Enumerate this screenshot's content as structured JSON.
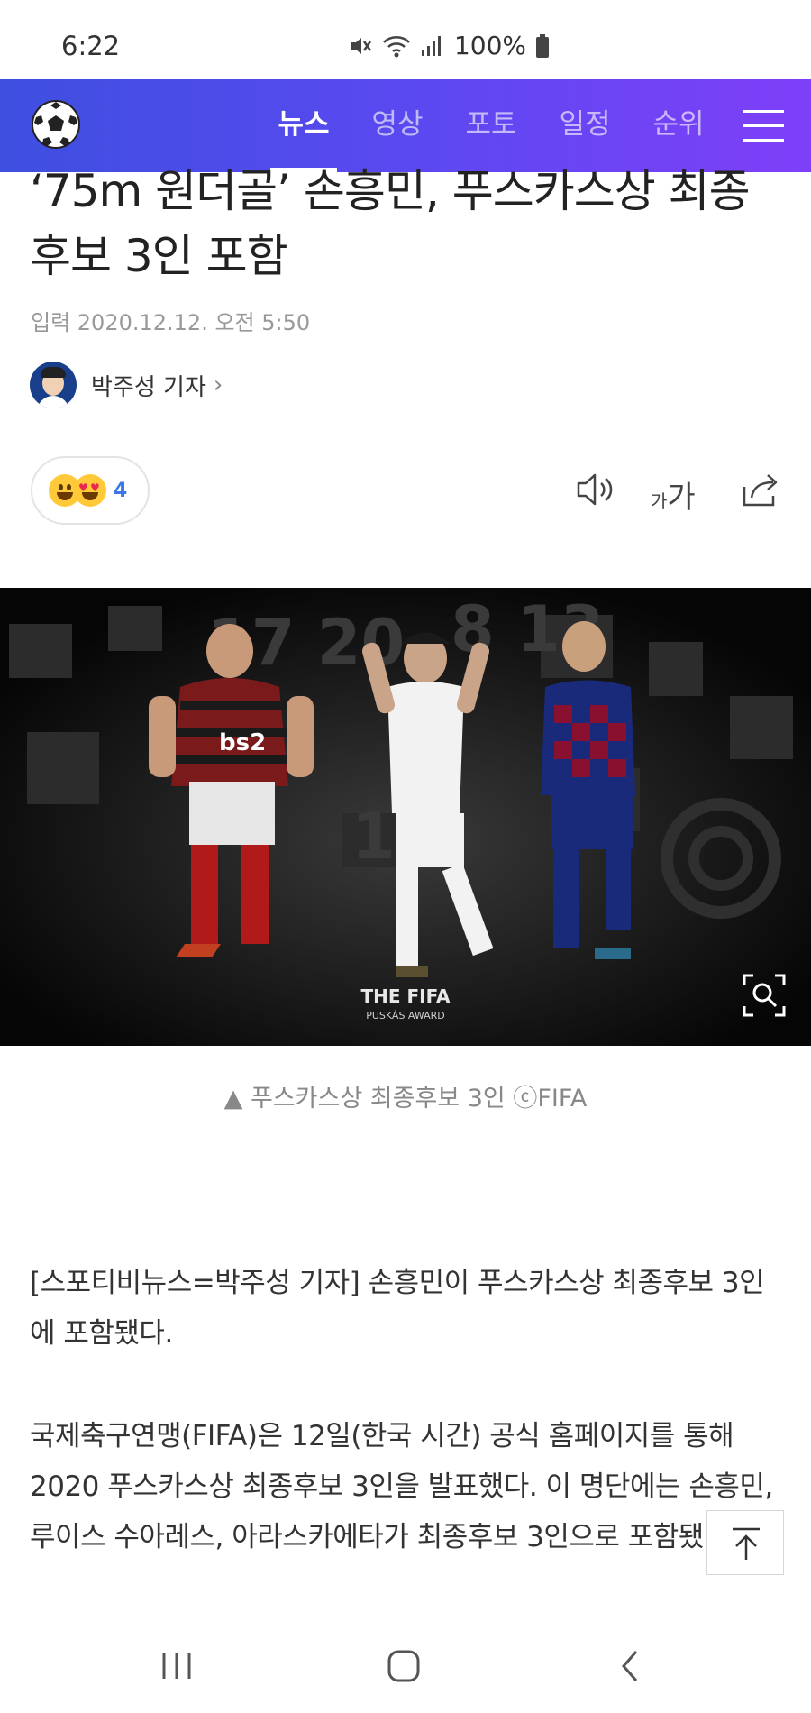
{
  "status_bar": {
    "time": "6:22",
    "battery": "100%",
    "icons": [
      "mute-icon",
      "wifi-icon",
      "signal-icon",
      "battery-icon"
    ]
  },
  "nav": {
    "logo_icon": "soccer-ball-icon",
    "tabs": [
      {
        "label": "뉴스",
        "active": true
      },
      {
        "label": "영상",
        "active": false
      },
      {
        "label": "포토",
        "active": false
      },
      {
        "label": "일정",
        "active": false
      },
      {
        "label": "순위",
        "active": false
      }
    ],
    "menu_icon": "hamburger-menu-icon",
    "colors": {
      "gradient_start": "#3e4fe0",
      "gradient_end": "#7f3ff8"
    }
  },
  "article": {
    "title_line1": "‘75m 원더골’ 손흥민, 푸스카스상 최종",
    "title_line2": "후보 3인 포함",
    "date": "입력 2020.12.12. 오전 5:50",
    "reporter": {
      "name": "박주성 기자",
      "chevron": "›"
    },
    "reactions": {
      "count": "4",
      "emojis": [
        "grinning-face-icon",
        "heart-eyes-face-icon"
      ]
    },
    "tools": {
      "speaker_icon": "speaker-icon",
      "font_small": "가",
      "font_large": "가",
      "share_icon": "share-icon"
    },
    "photo": {
      "logo_line1": "THE FIFA",
      "logo_line2": "PUSKÁS AWARD",
      "zoom_icon": "zoom-search-icon"
    },
    "caption": "▲ 푸스카스상 최종후보 3인 ⓒFIFA",
    "paragraphs": [
      "[스포티비뉴스=박주성 기자] 손흥민이 푸스카스상 최종후보 3인에 포함됐다.",
      "국제축구연맹(FIFA)은 12일(한국 시간) 공식 홈페이지를 통해 2020 푸스카스상 최종후보 3인을 발표했다. 이 명단에는 손흥민, 루이스 수아레스, 아라스카에타가 최종후보 3인으로 포함됐다."
    ]
  },
  "scroll_top_icon": "arrow-up-to-top-icon",
  "system_nav": {
    "recent_icon": "recent-apps-icon",
    "home_icon": "home-icon",
    "back_icon": "back-icon"
  }
}
